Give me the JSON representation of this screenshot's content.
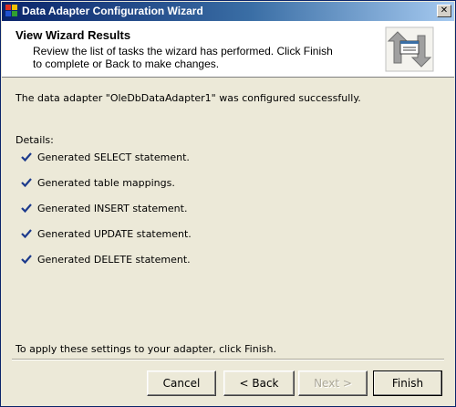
{
  "window": {
    "title": "Data Adapter Configuration Wizard",
    "close_glyph": "✕"
  },
  "header": {
    "title": "View Wizard Results",
    "description": "Review the list of tasks the wizard has performed. Click Finish to complete or Back to make changes."
  },
  "content": {
    "status_message": "The data adapter \"OleDbDataAdapter1\" was configured successfully.",
    "details_label": "Details:",
    "tasks": [
      {
        "label": "Generated SELECT statement."
      },
      {
        "label": "Generated table mappings."
      },
      {
        "label": "Generated INSERT statement."
      },
      {
        "label": "Generated UPDATE statement."
      },
      {
        "label": "Generated DELETE statement."
      }
    ],
    "footer_message": "To apply these settings to your adapter, click Finish."
  },
  "buttons": {
    "cancel": "Cancel",
    "back": "< Back",
    "next": "Next >",
    "finish": "Finish"
  },
  "colors": {
    "check": "#1c3a8c",
    "title_bar": "#0a246a"
  }
}
